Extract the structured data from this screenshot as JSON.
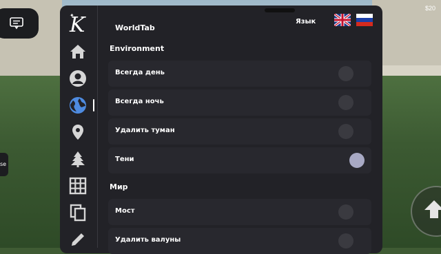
{
  "hud": {
    "money": "$20",
    "left_tab_text": "se"
  },
  "panel": {
    "logo_letter": "K",
    "tab_title": "WorldTab",
    "language_label": "Язык",
    "languages": [
      "English",
      "Русский"
    ],
    "nav_icons": [
      "home-icon",
      "user-icon",
      "globe-icon",
      "location-pin-icon",
      "tree-icon",
      "grid-icon",
      "copy-icon",
      "pencil-icon"
    ],
    "active_nav": "globe-icon",
    "sections": [
      {
        "title": "Environment",
        "rows": [
          {
            "label": "Всегда день",
            "on": false
          },
          {
            "label": "Всегда ночь",
            "on": false
          },
          {
            "label": "Удалить туман",
            "on": false
          },
          {
            "label": "Тени",
            "on": true
          }
        ]
      },
      {
        "title": "Мир",
        "rows": [
          {
            "label": "Мост",
            "on": false
          },
          {
            "label": "Удалить валуны",
            "on": false
          }
        ]
      }
    ]
  },
  "colors": {
    "panel_bg": "#222227",
    "row_bg": "#28282e",
    "toggle_off": "#3a3a40",
    "toggle_on": "#a8a9c4"
  }
}
